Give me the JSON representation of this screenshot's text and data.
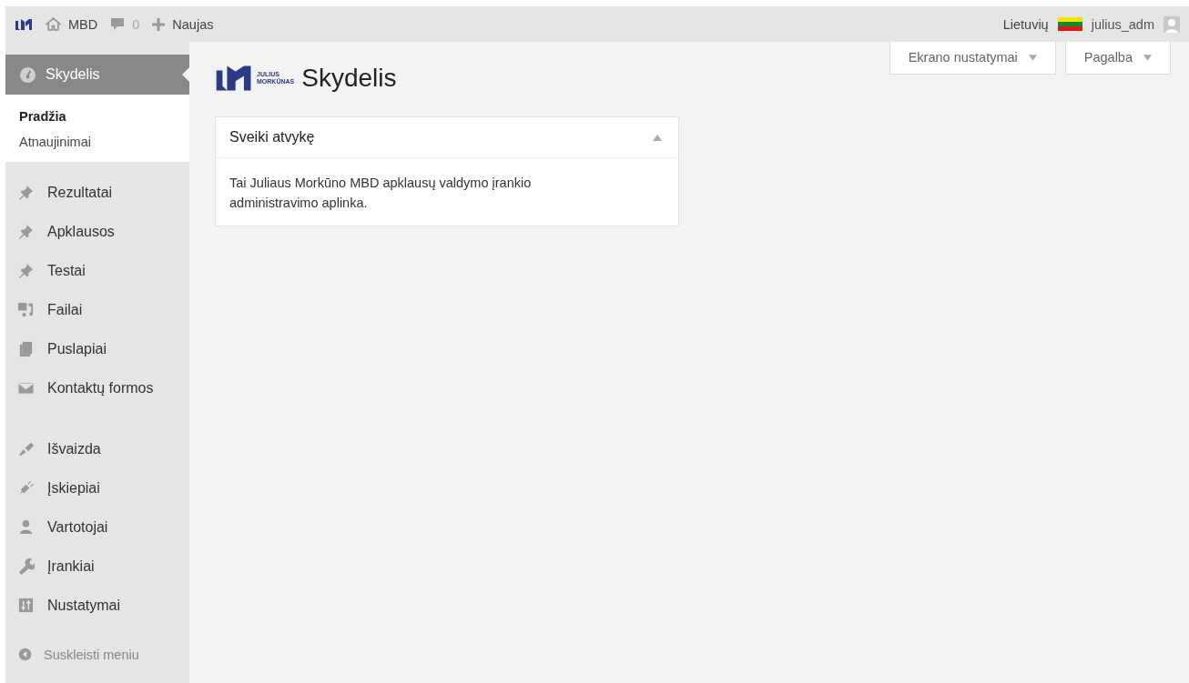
{
  "admin_bar": {
    "site": "MBD",
    "comments": "0",
    "new": "Naujas",
    "language": "Lietuvių",
    "user": "julius_adm"
  },
  "sidebar": {
    "active": {
      "label": "Skydelis",
      "selected": true,
      "submenu": [
        {
          "label": "Pradžia",
          "selected": true
        },
        {
          "label": "Atnaujinimai",
          "selected": false
        }
      ]
    },
    "groups": [
      {
        "items": [
          {
            "label": "Rezultatai",
            "kind": "pin"
          },
          {
            "label": "Apklausos",
            "kind": "pin"
          },
          {
            "label": "Testai",
            "kind": "pin"
          },
          {
            "label": "Failai",
            "kind": "media"
          },
          {
            "label": "Puslapiai",
            "kind": "pages"
          },
          {
            "label": "Kontaktų formos",
            "kind": "mail"
          }
        ]
      },
      {
        "items": [
          {
            "label": "Išvaizda",
            "kind": "brush"
          },
          {
            "label": "Įskiepiai",
            "kind": "plug"
          },
          {
            "label": "Vartotojai",
            "kind": "user"
          },
          {
            "label": "Įrankiai",
            "kind": "wrench"
          },
          {
            "label": "Nustatymai",
            "kind": "settings"
          }
        ]
      }
    ],
    "collapse": "Suskleisti meniu"
  },
  "screen_buttons": [
    "Ekrano nustatymai",
    "Pagalba"
  ],
  "header": {
    "logo_lines": [
      "JULIUS",
      "MORKŪNAS"
    ],
    "title": "Skydelis"
  },
  "widget": {
    "title": "Sveiki atvykę",
    "expanded": true,
    "text": "Tai Juliaus Morkūno MBD apklausų valdymo įrankio administravimo aplinka."
  }
}
